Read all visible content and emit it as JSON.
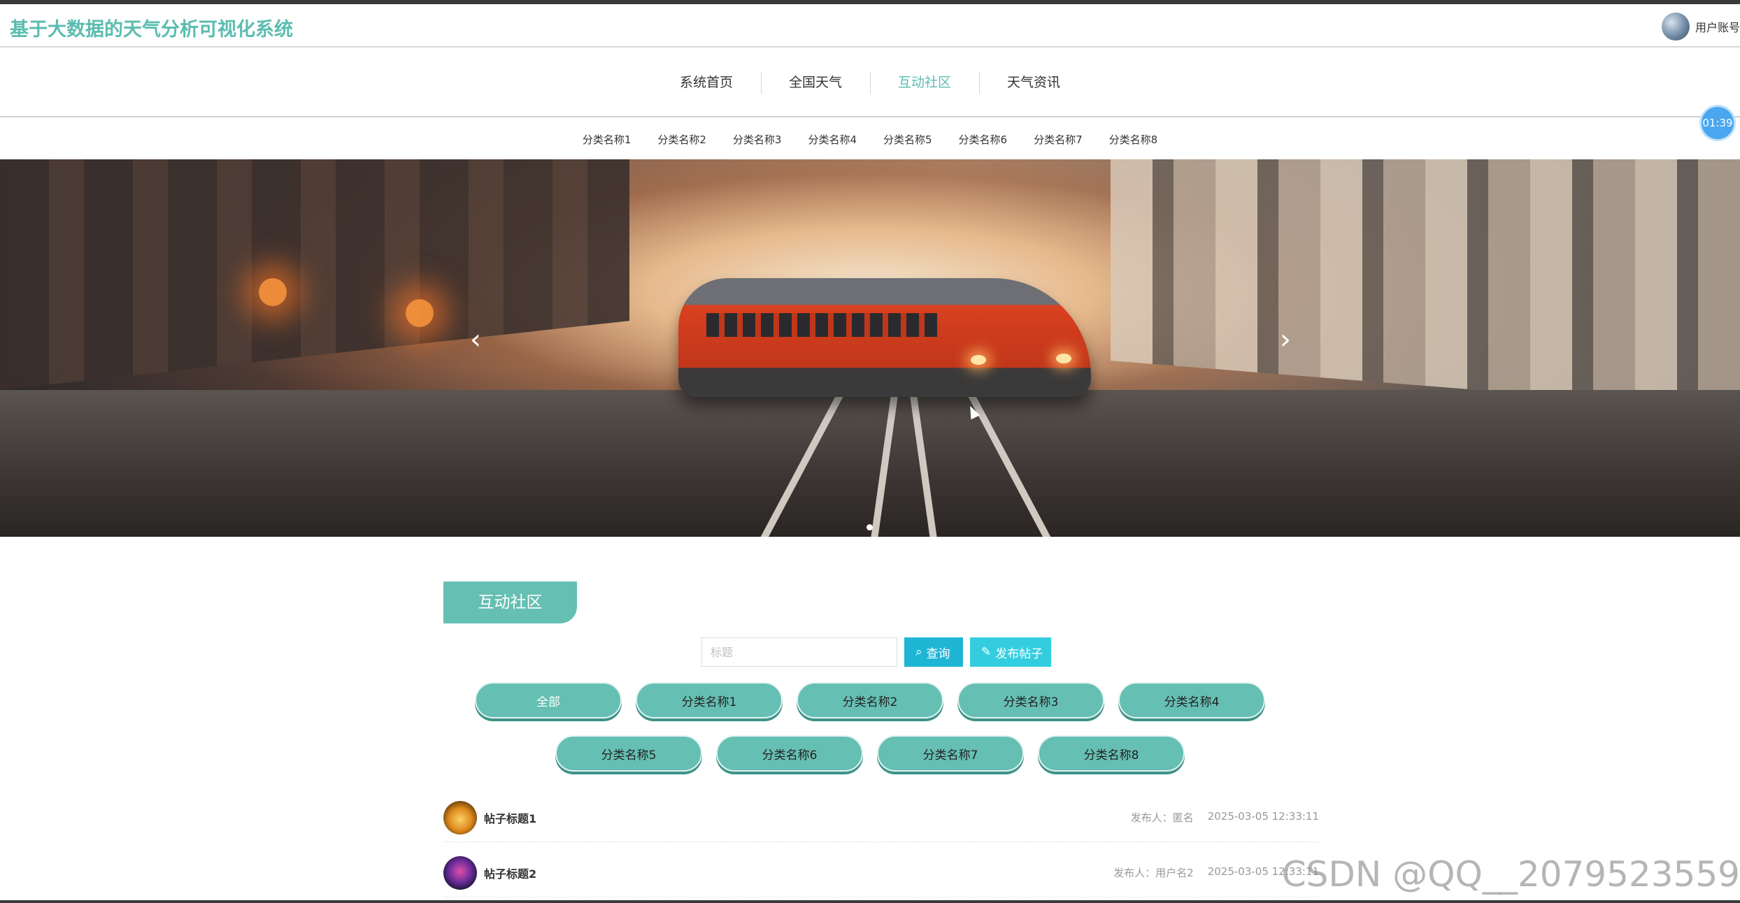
{
  "header": {
    "site_title": "基于大数据的天气分析可视化系统",
    "user_label": "用户账号"
  },
  "main_nav": {
    "items": [
      {
        "label": "系统首页",
        "active": false
      },
      {
        "label": "全国天气",
        "active": false
      },
      {
        "label": "互动社区",
        "active": true
      },
      {
        "label": "天气资讯",
        "active": false
      }
    ]
  },
  "clock": {
    "time": "01:39"
  },
  "sub_nav": {
    "items": [
      "分类名称1",
      "分类名称2",
      "分类名称3",
      "分类名称4",
      "分类名称5",
      "分类名称6",
      "分类名称7",
      "分类名称8"
    ]
  },
  "banner": {
    "prev_icon": "‹",
    "next_icon": "›"
  },
  "community": {
    "section_title": "互动社区",
    "search": {
      "placeholder": "标题",
      "value": ""
    },
    "query_label": "查询",
    "post_label": "发布帖子",
    "categories_row1": [
      "全部",
      "分类名称1",
      "分类名称2",
      "分类名称3",
      "分类名称4"
    ],
    "categories_row2": [
      "分类名称5",
      "分类名称6",
      "分类名称7",
      "分类名称8"
    ],
    "posts": [
      {
        "title": "帖子标题1",
        "publisher": "发布人：匿名",
        "time": "2025-03-05 12:33:11"
      },
      {
        "title": "帖子标题2",
        "publisher": "发布人：用户名2",
        "time": "2025-03-05 12:33:11"
      }
    ]
  },
  "watermark": "CSDN @QQ__2079523559",
  "colors": {
    "accent": "#5bbcb0",
    "pill": "#66bfb3",
    "query_btn": "#1fb6d6",
    "post_btn": "#34cde0",
    "clock": "#4aa7ef"
  }
}
